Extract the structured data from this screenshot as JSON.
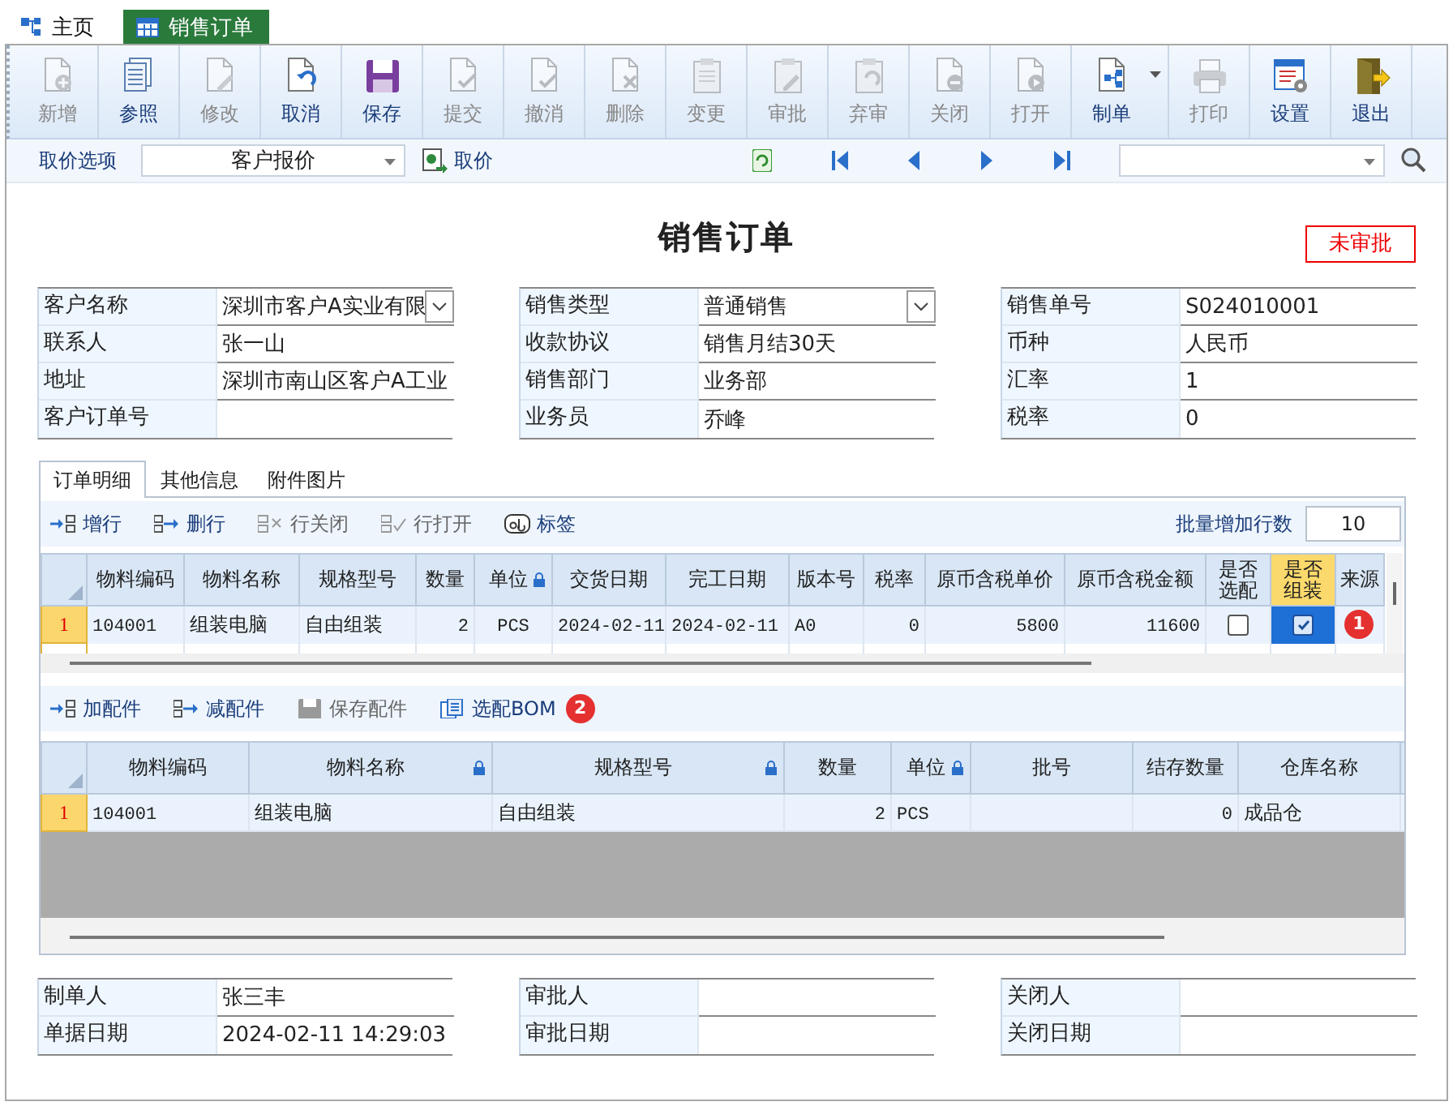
{
  "tabs": [
    {
      "label": "主页",
      "selected": false
    },
    {
      "label": "销售订单",
      "selected": true
    }
  ],
  "toolbar": [
    {
      "label": "新增",
      "disabled": true
    },
    {
      "label": "参照",
      "disabled": false
    },
    {
      "label": "修改",
      "disabled": true
    },
    {
      "label": "取消",
      "disabled": false
    },
    {
      "label": "保存",
      "disabled": false
    },
    {
      "label": "提交",
      "disabled": true
    },
    {
      "label": "撤消",
      "disabled": true
    },
    {
      "label": "删除",
      "disabled": true
    },
    {
      "label": "变更",
      "disabled": true
    },
    {
      "label": "审批",
      "disabled": true
    },
    {
      "label": "弃审",
      "disabled": true
    },
    {
      "label": "关闭",
      "disabled": true
    },
    {
      "label": "打开",
      "disabled": true
    },
    {
      "label": "制单",
      "disabled": false,
      "dropdown": true
    },
    {
      "label": "打印",
      "disabled": true
    },
    {
      "label": "设置",
      "disabled": false
    },
    {
      "label": "退出",
      "disabled": false
    }
  ],
  "price_bar": {
    "option_label": "取价选项",
    "option_value": "客户报价",
    "fetch_button": "取价"
  },
  "title": "销售订单",
  "status": "未审批",
  "header_forms": [
    [
      {
        "label": "客户名称",
        "value": "深圳市客户A实业有限",
        "dropdown": true
      },
      {
        "label": "联系人",
        "value": "张一山"
      },
      {
        "label": "地址",
        "value": "深圳市南山区客户A工业"
      },
      {
        "label": "客户订单号"
      }
    ],
    [
      {
        "label": "销售类型",
        "value": "普通销售",
        "dropdown": true
      },
      {
        "label": "收款协议",
        "value": "销售月结30天"
      },
      {
        "label": "销售部门",
        "value": "业务部"
      },
      {
        "label": "业务员",
        "value": "乔峰"
      }
    ],
    [
      {
        "label": "销售单号",
        "value": "S024010001"
      },
      {
        "label": "币种",
        "value": "人民币"
      },
      {
        "label": "汇率",
        "value": "1"
      },
      {
        "label": "税率",
        "value": "0"
      }
    ]
  ],
  "detail_tabs": [
    {
      "label": "订单明细",
      "selected": true
    },
    {
      "label": "其他信息",
      "selected": false
    },
    {
      "label": "附件图片",
      "selected": false
    }
  ],
  "detail_toolbar": {
    "actions": [
      {
        "label": "增行",
        "disabled": false
      },
      {
        "label": "删行",
        "disabled": false
      },
      {
        "label": "行关闭",
        "disabled": true
      },
      {
        "label": "行打开",
        "disabled": true
      },
      {
        "label": "标签",
        "disabled": false
      }
    ],
    "batch_label": "批量增加行数",
    "batch_value": "10"
  },
  "order_grid": {
    "columns": [
      {
        "label": "物料编码",
        "kind": "code",
        "locked": false,
        "selected": false
      },
      {
        "label": "物料名称",
        "kind": "text",
        "locked": false,
        "selected": false
      },
      {
        "label": "规格型号",
        "kind": "text",
        "locked": false,
        "selected": false
      },
      {
        "label": "数量",
        "kind": "number",
        "locked": false,
        "selected": false
      },
      {
        "label": "单位",
        "kind": "code-center",
        "locked": true,
        "selected": false
      },
      {
        "label": "交货日期",
        "kind": "code",
        "locked": false,
        "selected": false
      },
      {
        "label": "完工日期",
        "kind": "code",
        "locked": false,
        "selected": false
      },
      {
        "label": "版本号",
        "kind": "code",
        "locked": false,
        "selected": false
      },
      {
        "label": "税率",
        "kind": "number",
        "locked": false,
        "selected": false
      },
      {
        "label": "原币含税单价",
        "kind": "number",
        "locked": false,
        "selected": false
      },
      {
        "label": "原币含税金额",
        "kind": "number",
        "locked": false,
        "selected": false
      },
      {
        "label": "是否选配",
        "kind": "check",
        "locked": false,
        "selected": false
      },
      {
        "label": "是否组装",
        "kind": "check",
        "locked": false,
        "selected": true
      },
      {
        "label": "来源",
        "kind": "text",
        "locked": false,
        "selected": false
      }
    ],
    "rows": [
      {
        "number": "1",
        "cells": [
          "104001",
          "组装电脑",
          "自由组装",
          "2",
          "PCS",
          "2024-02-11",
          "2024-02-11",
          "A0",
          "0",
          "5800",
          "11600",
          {
            "checked": false,
            "selected": false
          },
          {
            "checked": true,
            "selected": true,
            "badge": "1"
          }
        ]
      }
    ]
  },
  "parts_toolbar": [
    {
      "label": "加配件",
      "disabled": false
    },
    {
      "label": "减配件",
      "disabled": false
    },
    {
      "label": "保存配件",
      "disabled": true
    },
    {
      "label": "选配BOM",
      "disabled": false,
      "badge": "2"
    }
  ],
  "parts_grid": {
    "columns": [
      {
        "label": "物料编码",
        "kind": "code",
        "locked": false
      },
      {
        "label": "物料名称",
        "kind": "text",
        "locked": true
      },
      {
        "label": "规格型号",
        "kind": "text",
        "locked": true
      },
      {
        "label": "数量",
        "kind": "number",
        "locked": false
      },
      {
        "label": "单位",
        "kind": "code",
        "locked": true
      },
      {
        "label": "批号",
        "kind": "text",
        "locked": false
      },
      {
        "label": "结存数量",
        "kind": "number",
        "locked": false
      },
      {
        "label": "仓库名称",
        "kind": "text",
        "locked": false
      }
    ],
    "rows": [
      {
        "number": "1",
        "cells": [
          "104001",
          "组装电脑",
          "自由组装",
          "2",
          "PCS",
          null,
          "0",
          "成品仓"
        ]
      }
    ]
  },
  "footer_forms": [
    [
      {
        "label": "制单人",
        "value": "张三丰"
      },
      {
        "label": "单据日期",
        "value": "2024-02-11 14:29:03"
      }
    ],
    [
      {
        "label": "审批人"
      },
      {
        "label": "审批日期"
      }
    ],
    [
      {
        "label": "关闭人"
      },
      {
        "label": "关闭日期"
      }
    ]
  ]
}
